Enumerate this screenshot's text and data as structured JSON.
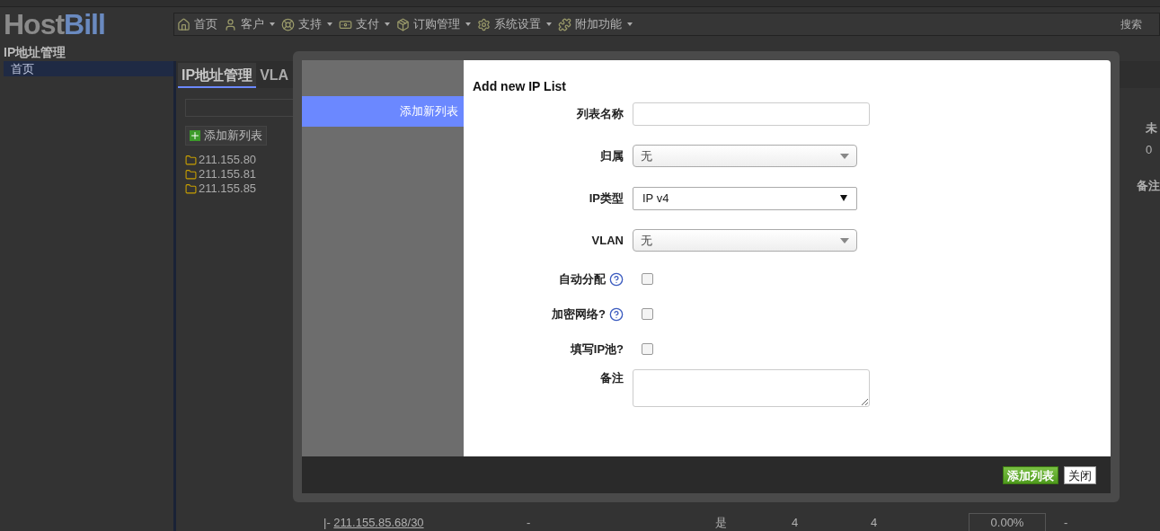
{
  "header": {
    "logo_host": "Host",
    "logo_bill": "Bill",
    "nav": [
      {
        "label": "首页",
        "dropdown": false
      },
      {
        "label": "客户",
        "dropdown": true
      },
      {
        "label": "支持",
        "dropdown": true
      },
      {
        "label": "支付",
        "dropdown": true
      },
      {
        "label": "订购管理",
        "dropdown": true
      },
      {
        "label": "系统设置",
        "dropdown": true
      },
      {
        "label": "附加功能",
        "dropdown": true
      }
    ],
    "search_placeholder": "搜索"
  },
  "page_title": "IP地址管理",
  "sidebar": {
    "items": [
      {
        "label": "首页",
        "selected": true
      }
    ]
  },
  "tabs": [
    {
      "label": "IP地址管理",
      "selected": true
    },
    {
      "label": "VLA",
      "selected": false
    }
  ],
  "left_panel": {
    "add_button": "添加新列表",
    "tree": [
      {
        "label": "211.155.80"
      },
      {
        "label": "211.155.81"
      },
      {
        "label": "211.155.85"
      }
    ]
  },
  "table": {
    "header_1": "未",
    "cell_1": "0",
    "header_2": "备注",
    "last_row": {
      "prefix": "|-",
      "network": "211.155.85.68/30",
      "column_2": "-",
      "column_3": "是",
      "column_4": "4",
      "column_5": "4",
      "usage": "0.00%",
      "level": 0,
      "column_7": "-"
    }
  },
  "modal": {
    "sidebar_items": [
      {
        "label": "添加新列表",
        "selected": true
      }
    ],
    "title": "Add new IP List",
    "fields": [
      {
        "kind": "text",
        "label": "列表名称"
      },
      {
        "kind": "select",
        "label": "归属",
        "value": "无"
      },
      {
        "kind": "native_select",
        "label": "IP类型",
        "value": "IP v4"
      },
      {
        "kind": "select",
        "label": "VLAN",
        "value": "无"
      },
      {
        "kind": "checkbox",
        "label": "自动分配",
        "help": true,
        "checked": false
      },
      {
        "kind": "checkbox",
        "label": "加密网络?",
        "help": true,
        "checked": false
      },
      {
        "kind": "checkbox",
        "label": "填写IP池?",
        "help": false,
        "checked": false
      },
      {
        "kind": "textarea",
        "label": "备注"
      }
    ],
    "buttons": [
      {
        "label": "添加列表",
        "kind": "primary"
      },
      {
        "label": "关闭",
        "kind": "secondary"
      }
    ]
  }
}
